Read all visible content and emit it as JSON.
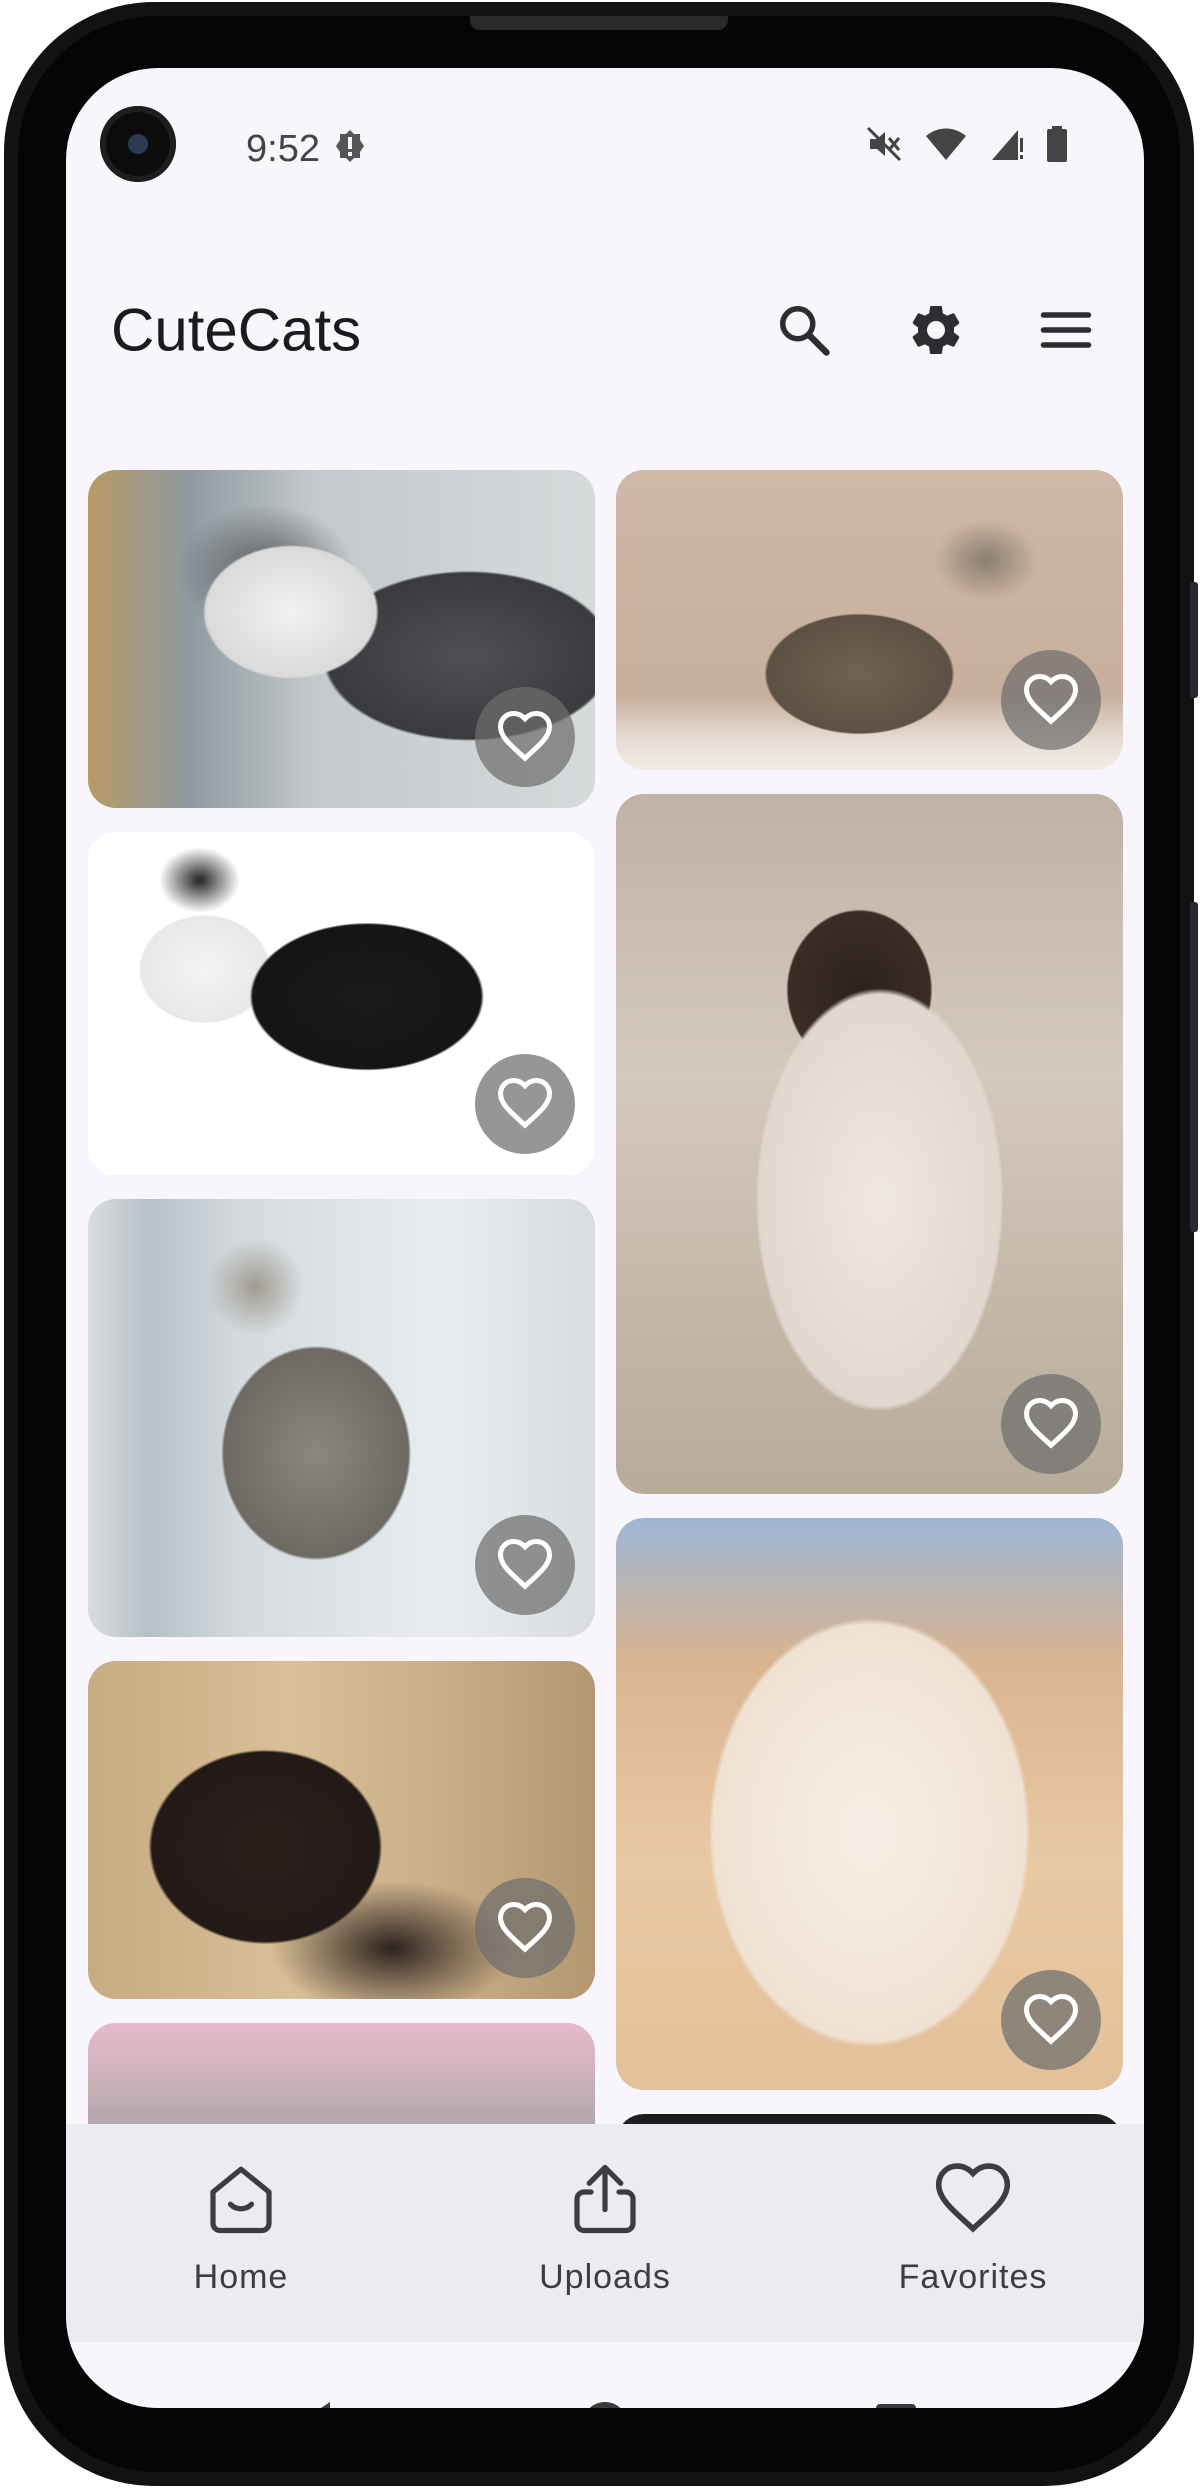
{
  "status_bar": {
    "time": "9:52"
  },
  "app_bar": {
    "title": "CuteCats"
  },
  "cards": [
    {
      "photo": "gray-and-white cat on wire fence",
      "favorited": false
    },
    {
      "photo": "tabby cat standing",
      "favorited": false
    },
    {
      "photo": "black-and-white cat standing",
      "favorited": false
    },
    {
      "photo": "fluffy colorpoint cat sitting",
      "favorited": false
    },
    {
      "photo": "spotted silver cat looking up",
      "favorited": false
    },
    {
      "photo": "cream exotic shorthair cat",
      "favorited": false
    },
    {
      "photo": "dark brown oriental cat",
      "favorited": false
    },
    {
      "photo": "cat photo (partially visible)",
      "favorited": false
    },
    {
      "photo": "cat photo (partially visible)",
      "favorited": false
    }
  ],
  "bottom_nav": {
    "home": "Home",
    "uploads": "Uploads",
    "favorites": "Favorites"
  },
  "colors": {
    "background": "#f8f5fd",
    "bottom_nav": "#ecebf2",
    "icon": "#3c3c44",
    "favorite_button": "#6e6e6e"
  }
}
